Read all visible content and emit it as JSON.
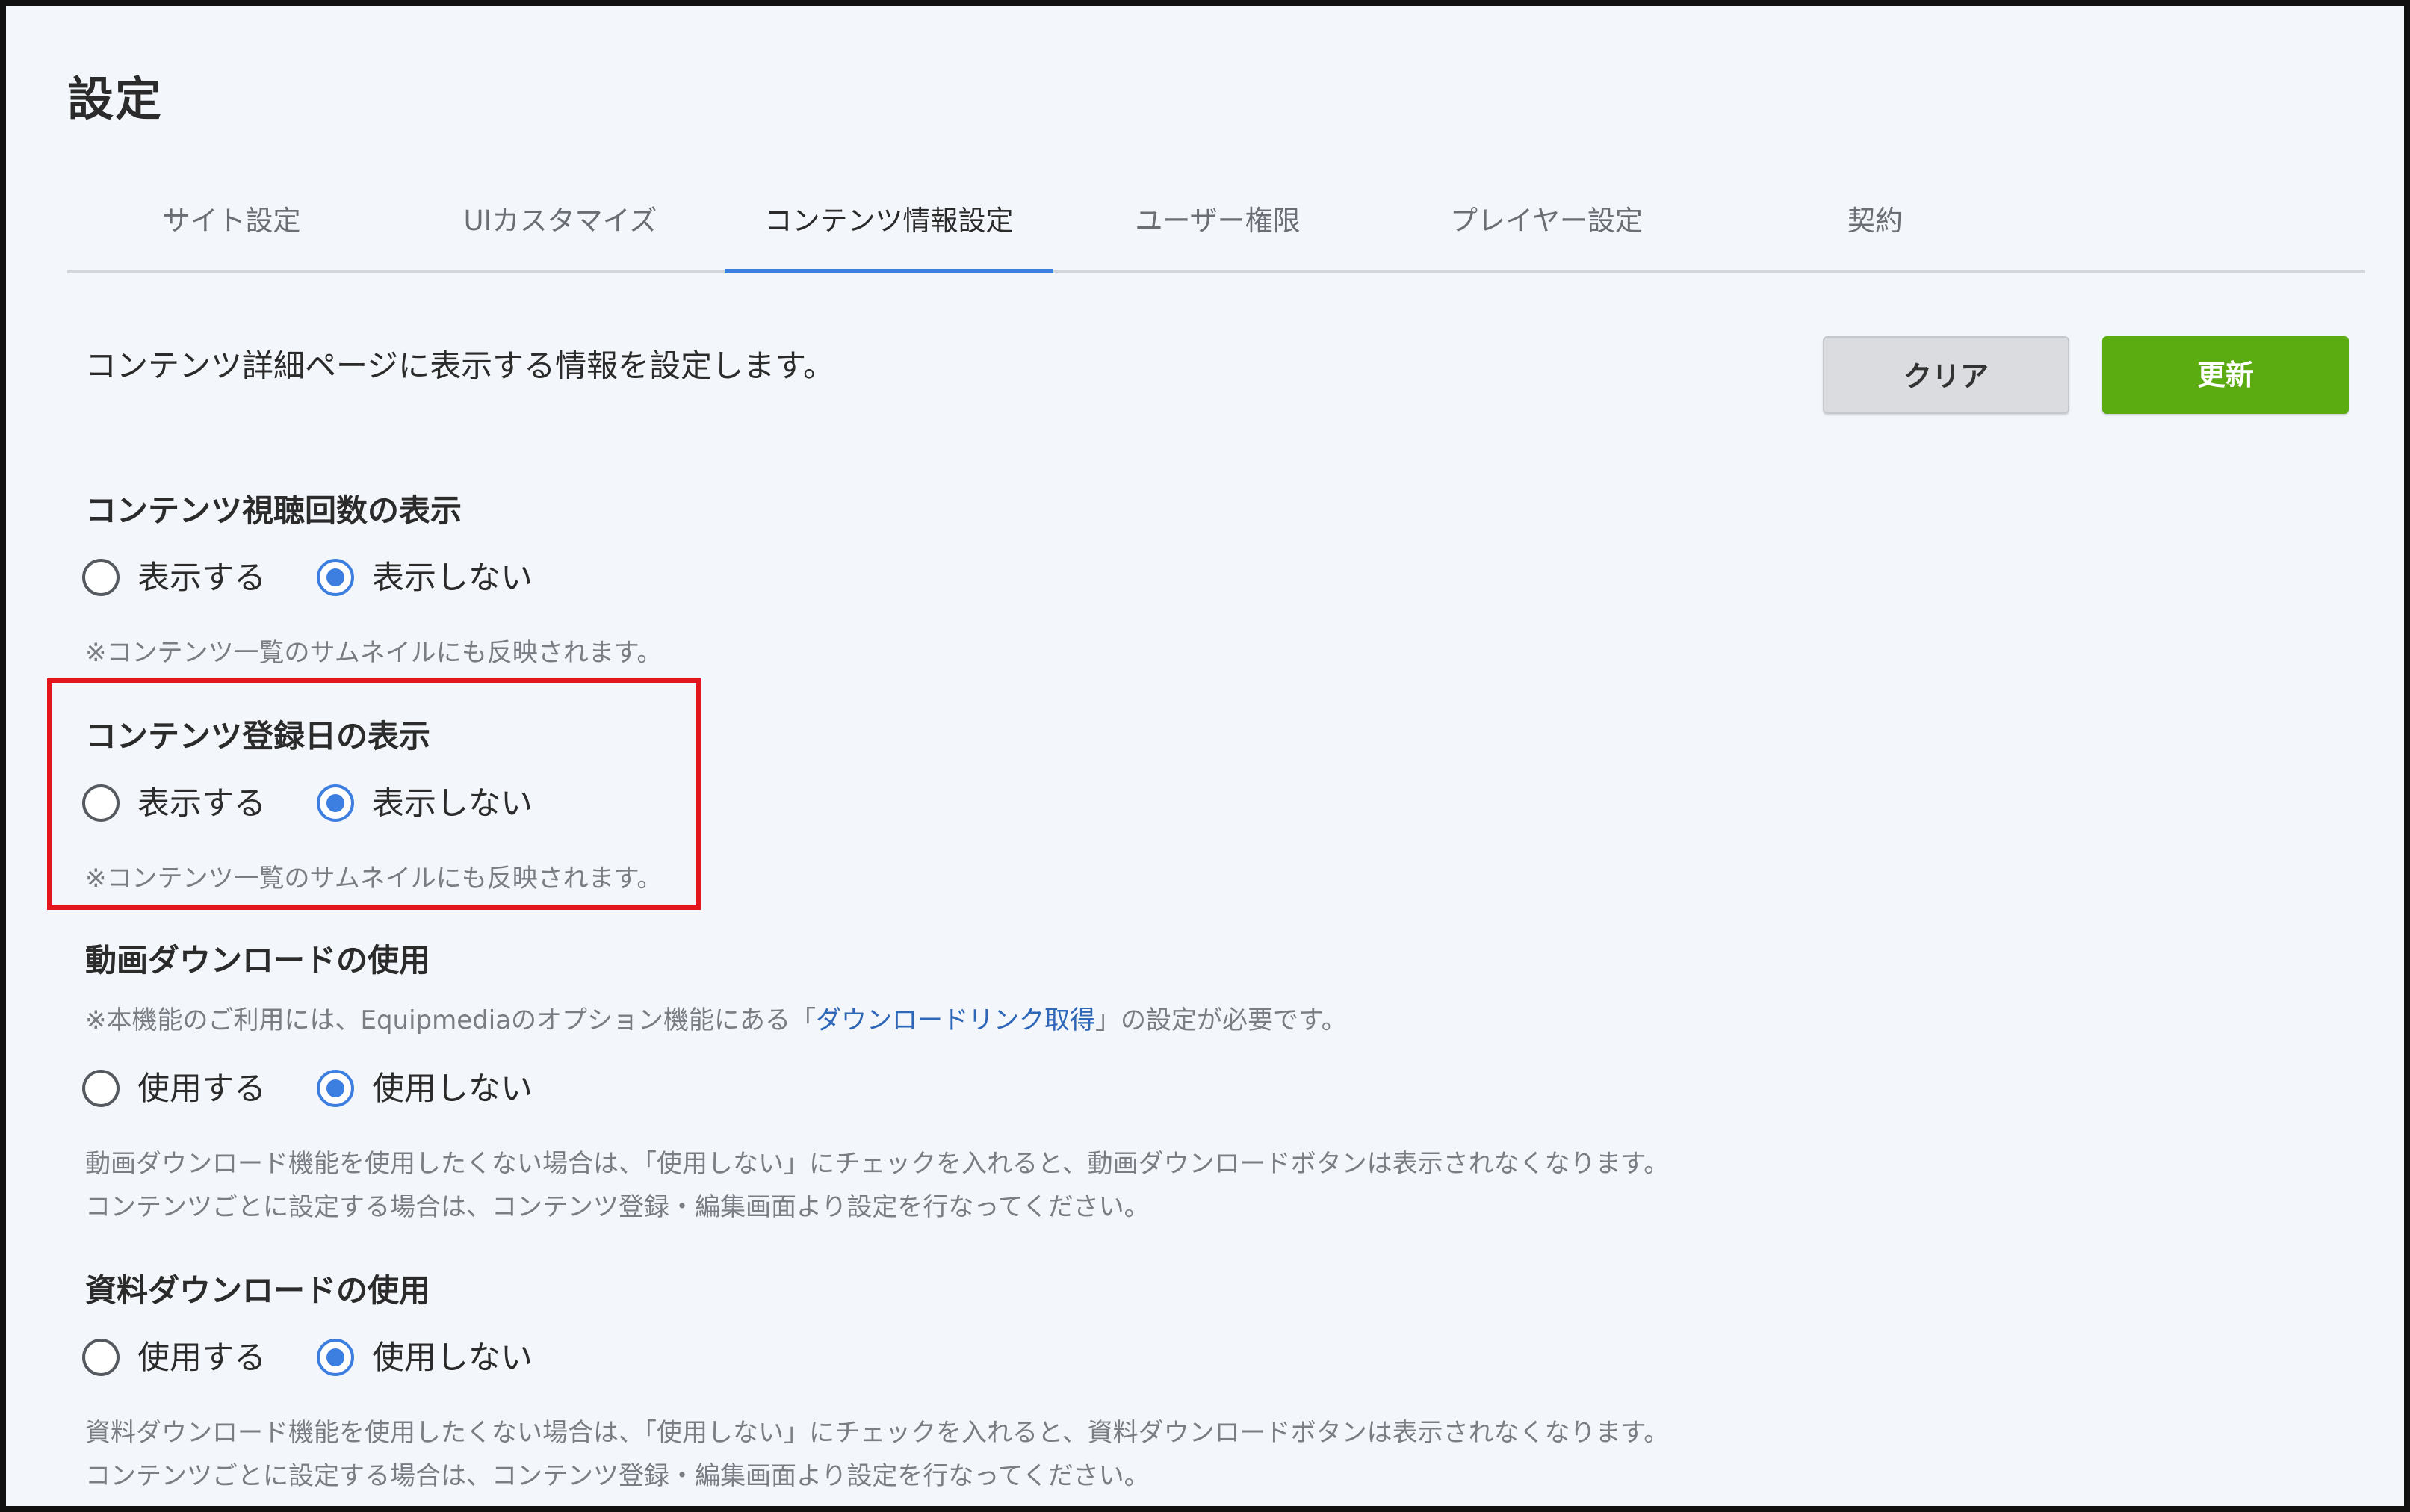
{
  "page": {
    "title": "設定",
    "description": "コンテンツ詳細ページに表示する情報を設定します。"
  },
  "tabs": [
    {
      "label": "サイト設定",
      "active": false
    },
    {
      "label": "UIカスタマイズ",
      "active": false
    },
    {
      "label": "コンテンツ情報設定",
      "active": true
    },
    {
      "label": "ユーザー権限",
      "active": false
    },
    {
      "label": "プレイヤー設定",
      "active": false
    },
    {
      "label": "契約",
      "active": false
    }
  ],
  "actions": {
    "clear_label": "クリア",
    "update_label": "更新"
  },
  "sections": {
    "view_count": {
      "heading": "コンテンツ視聴回数の表示",
      "option_on": "表示する",
      "option_off": "表示しない",
      "selected": "off",
      "note": "※コンテンツ一覧のサムネイルにも反映されます。"
    },
    "registration_date": {
      "heading": "コンテンツ登録日の表示",
      "option_on": "表示する",
      "option_off": "表示しない",
      "selected": "off",
      "note": "※コンテンツ一覧のサムネイルにも反映されます。"
    },
    "video_download": {
      "heading": "動画ダウンロードの使用",
      "requirement_prefix": "※本機能のご利用には、Equipmediaのオプション機能にある「",
      "requirement_link": "ダウンロードリンク取得",
      "requirement_suffix": "」の設定が必要です。",
      "option_on": "使用する",
      "option_off": "使用しない",
      "selected": "off",
      "note_line1": "動画ダウンロード機能を使用したくない場合は、「使用しない」にチェックを入れると、動画ダウンロードボタンは表示されなくなります。",
      "note_line2": "コンテンツごとに設定する場合は、コンテンツ登録・編集画面より設定を行なってください。"
    },
    "material_download": {
      "heading": "資料ダウンロードの使用",
      "option_on": "使用する",
      "option_off": "使用しない",
      "selected": "off",
      "note_line1": "資料ダウンロード機能を使用したくない場合は、「使用しない」にチェックを入れると、資料ダウンロードボタンは表示されなくなります。",
      "note_line2": "コンテンツごとに設定する場合は、コンテンツ登録・編集画面より設定を行なってください。"
    }
  },
  "colors": {
    "accent": "#3d7fe0",
    "update_button": "#5aac10",
    "highlight_border": "#e3161e",
    "link": "#2f67b8"
  }
}
